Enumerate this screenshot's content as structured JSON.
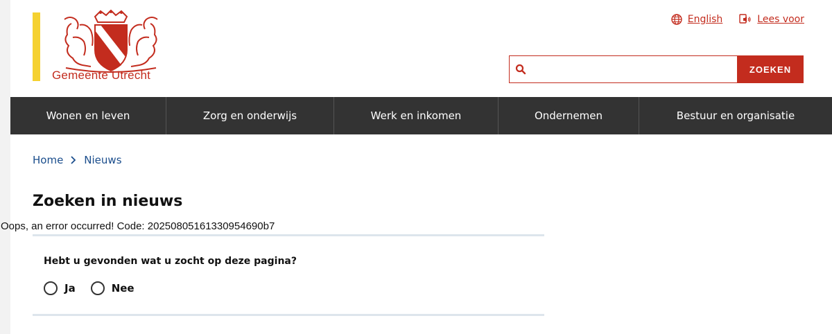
{
  "header": {
    "logo_text": "Gemeente Utrecht",
    "links": [
      {
        "label": "English",
        "icon": "globe-icon"
      },
      {
        "label": "Lees voor",
        "icon": "speaker-icon"
      }
    ]
  },
  "search": {
    "value": "",
    "placeholder": "",
    "button_label": "ZOEKEN"
  },
  "nav": {
    "items": [
      {
        "label": "Wonen en leven"
      },
      {
        "label": "Zorg en onderwijs"
      },
      {
        "label": "Werk en inkomen"
      },
      {
        "label": "Ondernemen"
      },
      {
        "label": "Bestuur en organisatie"
      }
    ]
  },
  "breadcrumb": {
    "items": [
      {
        "label": "Home"
      },
      {
        "label": "Nieuws"
      }
    ]
  },
  "main": {
    "title": "Zoeken in nieuws",
    "error": "Oops, an error occurred! Code: 20250805161330954690b7"
  },
  "feedback": {
    "question": "Hebt u gevonden wat u zocht op deze pagina?",
    "options": [
      {
        "label": "Ja"
      },
      {
        "label": "Nee"
      }
    ]
  },
  "colors": {
    "brand_red": "#c32c1e",
    "brand_yellow": "#f5d130",
    "nav_bg": "#333333",
    "link_blue": "#1a4d8c"
  }
}
